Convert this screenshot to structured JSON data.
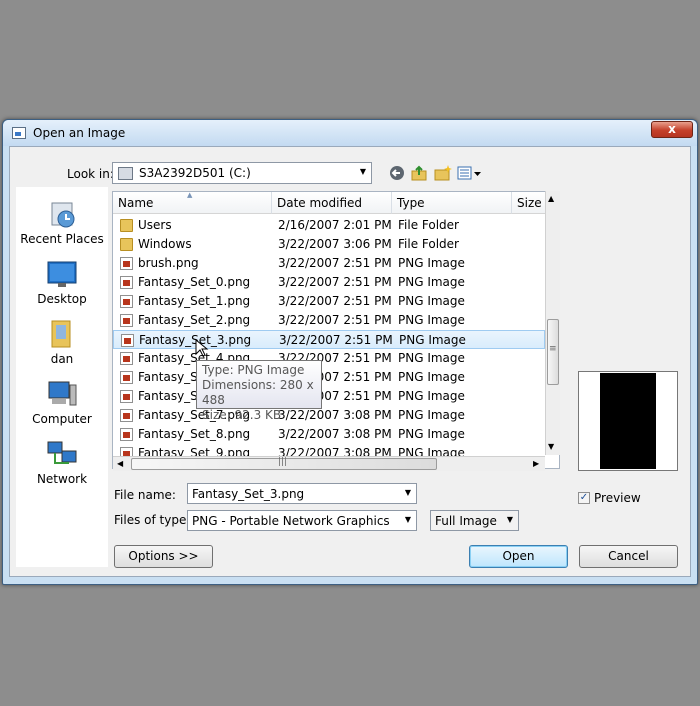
{
  "dialog": {
    "title": "Open an Image",
    "close_glyph": "x"
  },
  "toolbar": {
    "look_in_label": "Look in:",
    "look_in_value": "S3A2392D501 (C:)",
    "icons": [
      "back-icon",
      "up-folder-icon",
      "new-folder-icon",
      "view-menu-icon"
    ]
  },
  "places": [
    {
      "label": "Recent Places",
      "icon": "recent-places-icon"
    },
    {
      "label": "Desktop",
      "icon": "desktop-icon"
    },
    {
      "label": "dan",
      "icon": "user-folder-icon"
    },
    {
      "label": "Computer",
      "icon": "computer-icon"
    },
    {
      "label": "Network",
      "icon": "network-icon"
    }
  ],
  "columns": [
    "Name",
    "Date modified",
    "Type",
    "Size"
  ],
  "files": [
    {
      "name": "Users",
      "date": "2/16/2007 2:01 PM",
      "type": "File Folder",
      "kind": "folder"
    },
    {
      "name": "Windows",
      "date": "3/22/2007 3:06 PM",
      "type": "File Folder",
      "kind": "folder"
    },
    {
      "name": "brush.png",
      "date": "3/22/2007 2:51 PM",
      "type": "PNG Image",
      "kind": "png"
    },
    {
      "name": "Fantasy_Set_0.png",
      "date": "3/22/2007 2:51 PM",
      "type": "PNG Image",
      "kind": "png"
    },
    {
      "name": "Fantasy_Set_1.png",
      "date": "3/22/2007 2:51 PM",
      "type": "PNG Image",
      "kind": "png"
    },
    {
      "name": "Fantasy_Set_2.png",
      "date": "3/22/2007 2:51 PM",
      "type": "PNG Image",
      "kind": "png"
    },
    {
      "name": "Fantasy_Set_3.png",
      "date": "3/22/2007 2:51 PM",
      "type": "PNG Image",
      "kind": "png",
      "selected": true
    },
    {
      "name": "Fantasy_Set_4.png",
      "date": "3/22/2007 2:51 PM",
      "type": "PNG Image",
      "kind": "png"
    },
    {
      "name": "Fantasy_Set_5.png",
      "date": "3/22/2007 2:51 PM",
      "type": "PNG Image",
      "kind": "png"
    },
    {
      "name": "Fantasy_Set_6.png",
      "date": "3/22/2007 2:51 PM",
      "type": "PNG Image",
      "kind": "png"
    },
    {
      "name": "Fantasy_Set_7.png",
      "date": "3/22/2007 3:08 PM",
      "type": "PNG Image",
      "kind": "png"
    },
    {
      "name": "Fantasy_Set_8.png",
      "date": "3/22/2007 3:08 PM",
      "type": "PNG Image",
      "kind": "png"
    },
    {
      "name": "Fantasy_Set_9.png",
      "date": "3/22/2007 3:08 PM",
      "type": "PNG Image",
      "kind": "png"
    }
  ],
  "tooltip": {
    "type": "Type: PNG Image",
    "dimensions": "Dimensions: 280 x 488",
    "size": "Size: 92.3 KB"
  },
  "form": {
    "file_name_label": "File name:",
    "file_name_value": "Fantasy_Set_3.png",
    "files_of_type_label": "Files of type:",
    "files_of_type_value": "PNG - Portable Network Graphics",
    "size_mode_value": "Full Image"
  },
  "preview": {
    "label": "Preview",
    "checked": true,
    "check_glyph": "✓"
  },
  "buttons": {
    "options": "Options >>",
    "open": "Open",
    "cancel": "Cancel"
  },
  "glyphs": {
    "dropdown": "▼",
    "scroll_up": "▲",
    "scroll_down": "▼",
    "scroll_left": "◀",
    "scroll_right": "▶",
    "grip": "≡",
    "hgrip": "|||"
  }
}
